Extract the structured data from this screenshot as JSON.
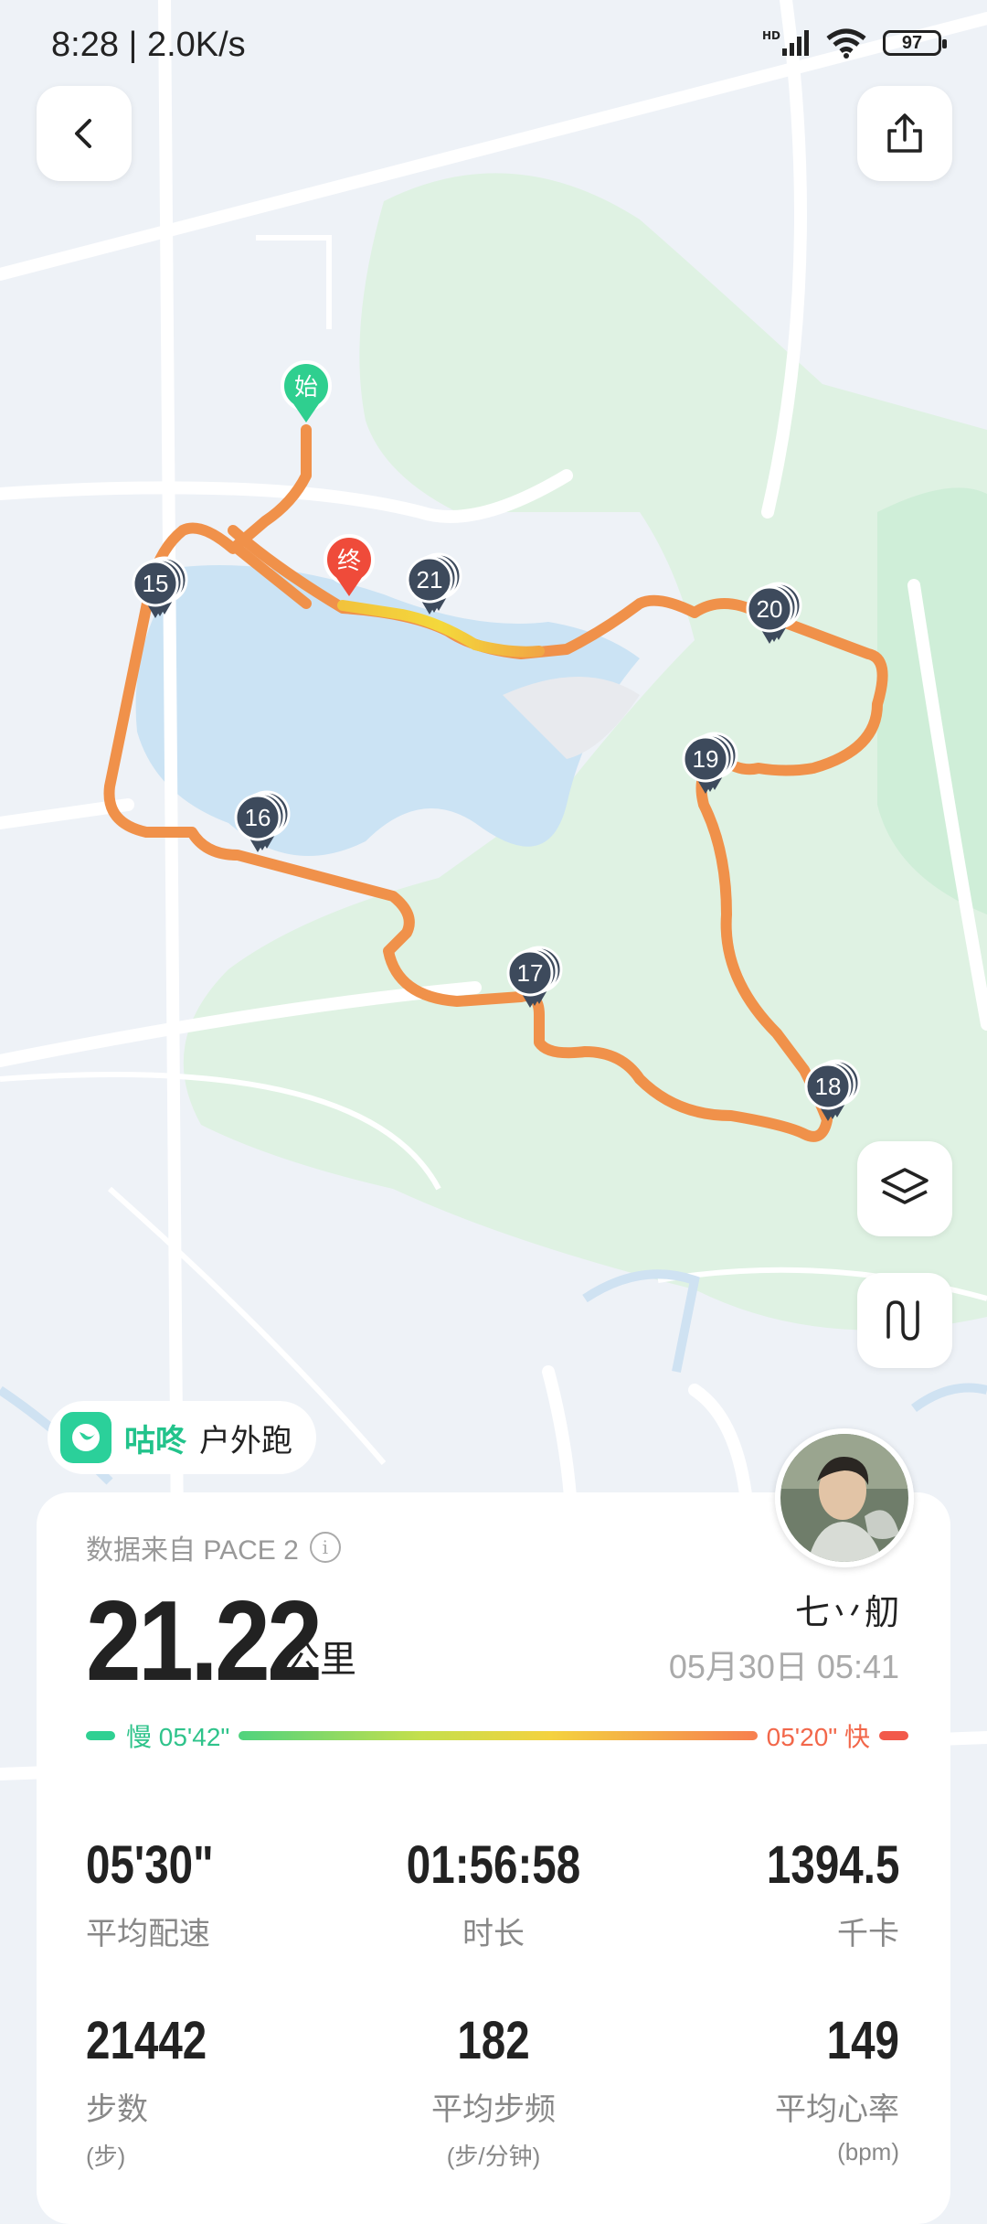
{
  "status_bar": {
    "time_speed": "8:28 | 2.0K/s",
    "battery": "97"
  },
  "map": {
    "start_label": "始",
    "end_label": "终",
    "km_markers": [
      "15",
      "16",
      "17",
      "18",
      "19",
      "20",
      "21"
    ]
  },
  "brand": {
    "name_green": "咕咚",
    "name_black": "户外跑"
  },
  "summary": {
    "source": "数据来自 PACE 2",
    "distance": "21.22",
    "distance_unit": "公里",
    "user_name": "七丷舠",
    "datetime": "05月30日 05:41",
    "pace_slow": "慢 05'42\"",
    "pace_fast": "05'20\" 快"
  },
  "stats": [
    {
      "value": "05'30\"",
      "label": "平均配速"
    },
    {
      "value": "01:56:58",
      "label": "时长"
    },
    {
      "value": "1394.5",
      "label": "千卡"
    },
    {
      "value": "21442",
      "label": "步数",
      "sub": "(步)"
    },
    {
      "value": "182",
      "label": "平均步频",
      "sub": "(步/分钟)"
    },
    {
      "value": "149",
      "label": "平均心率",
      "sub": "(bpm)"
    }
  ],
  "colors": {
    "accent_green": "#22c38b",
    "route_orange": "#f0914a",
    "end_red": "#ef4b3a",
    "marker_dark": "#3d4a5c"
  }
}
